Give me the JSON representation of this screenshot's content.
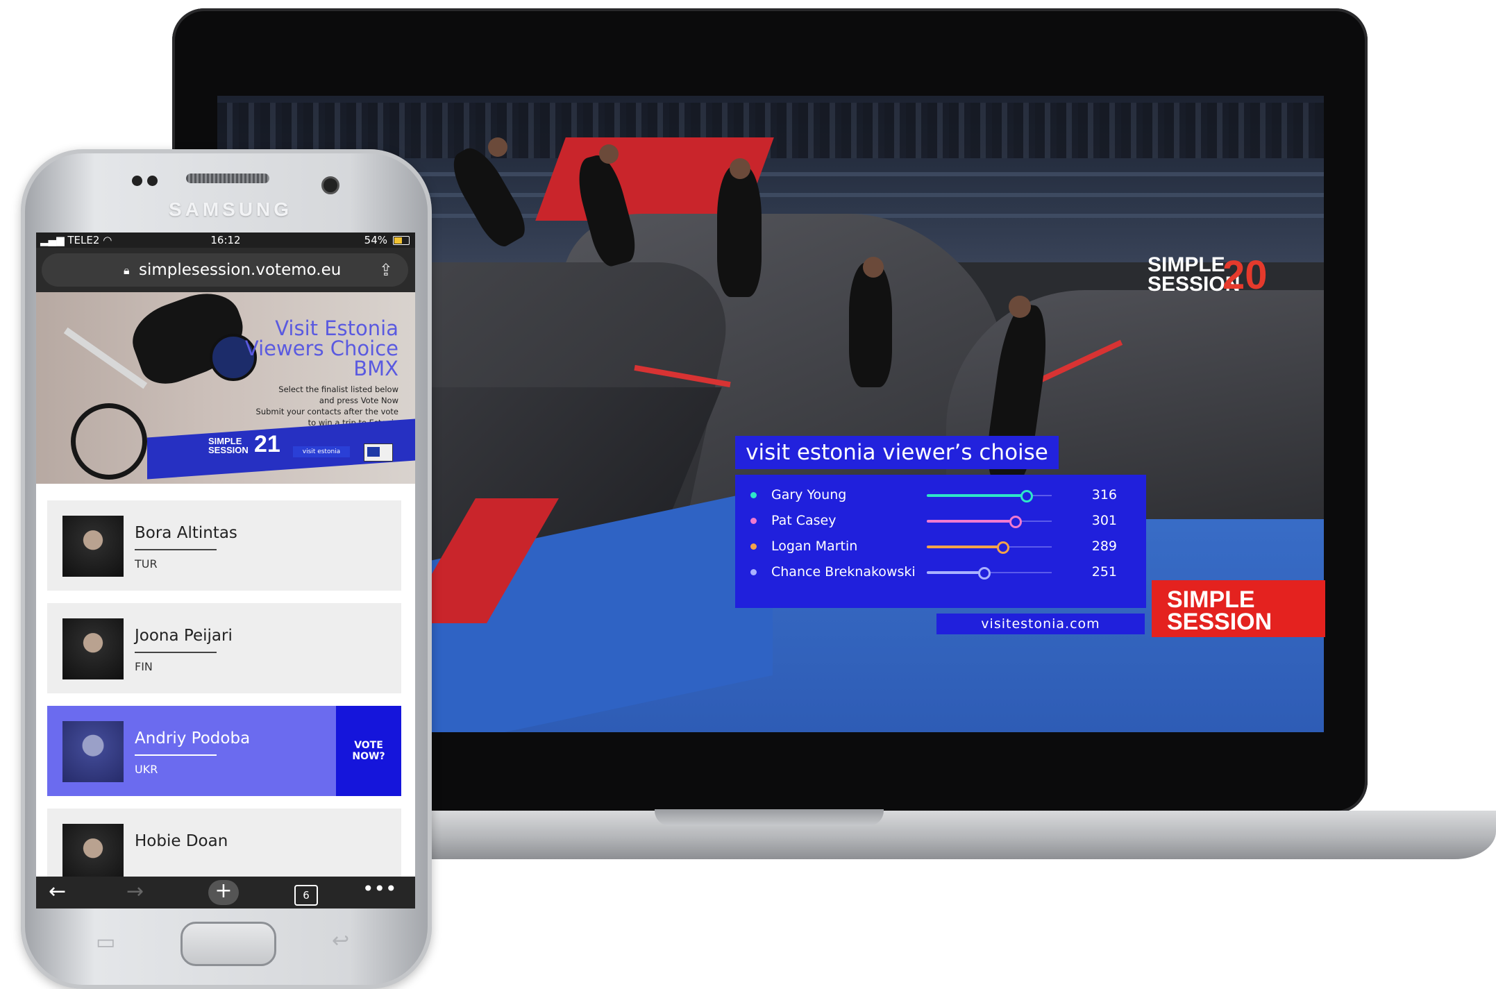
{
  "laptop": {
    "overlay_title": "visit estonia viewer’s choise",
    "results": [
      {
        "name": "Gary Young",
        "votes": "316",
        "color": "#2ee6c8",
        "fill_fraction": 0.79
      },
      {
        "name": "Pat Casey",
        "votes": "301",
        "color": "#f07ad0",
        "fill_fraction": 0.7
      },
      {
        "name": "Logan Martin",
        "votes": "289",
        "color": "#f3a24a",
        "fill_fraction": 0.6
      },
      {
        "name": "Chance Breknakowski",
        "votes": "251",
        "color": "#aab2ff",
        "fill_fraction": 0.45
      }
    ],
    "url": "visitestonia.com",
    "brand_logo": "SIMPLE\nSESSION",
    "event_logo_text": "SIMPLE\nSESSION",
    "event_logo_number": "20",
    "accent_blue": "#2020dc",
    "brand_red": "#e4221f"
  },
  "phone": {
    "brand": "SAMSUNG",
    "status": {
      "carrier": "TELE2",
      "time": "16:12",
      "battery": "54%"
    },
    "browser": {
      "url": "simplesession.votemo.eu"
    },
    "banner": {
      "title_line1": "Visit Estonia",
      "title_line2": "Viewers Choice",
      "title_line3": "BMX",
      "subtitle": "Select the finalist listed below\nand press Vote Now\nSubmit your contacts after the vote\nto win a trip to Estonia",
      "event_logo_text": "SIMPLE\nSESSION",
      "event_logo_number": "21",
      "visit_badge": "visit estonia"
    },
    "riders": [
      {
        "name": "Bora Altintas",
        "country": "TUR",
        "active": false
      },
      {
        "name": "Joona Peijari",
        "country": "FIN",
        "active": false
      },
      {
        "name": "Andriy Podoba",
        "country": "UKR",
        "active": true,
        "vote_label": "VOTE\nNOW?"
      },
      {
        "name": "Hobie Doan",
        "country": "",
        "active": false
      }
    ],
    "toolbar": {
      "tab_count": "6"
    }
  }
}
